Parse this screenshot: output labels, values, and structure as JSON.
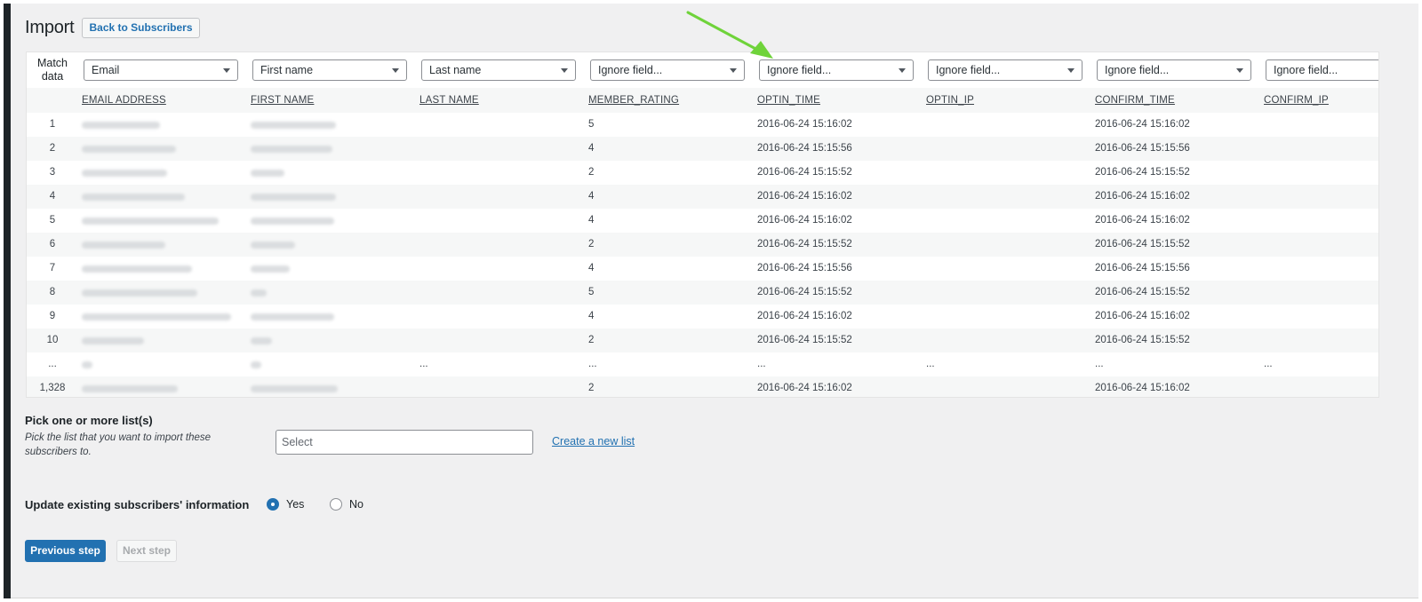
{
  "header": {
    "title": "Import",
    "back_button": "Back to Subscribers"
  },
  "match": {
    "label_line1": "Match",
    "label_line2": "data",
    "selects": [
      "Email",
      "First name",
      "Last name",
      "Ignore field...",
      "Ignore field...",
      "Ignore field...",
      "Ignore field...",
      "Ignore field..."
    ]
  },
  "columns": [
    "EMAIL ADDRESS",
    "FIRST NAME",
    "LAST NAME",
    "MEMBER_RATING",
    "OPTIN_TIME",
    "OPTIN_IP",
    "CONFIRM_TIME",
    "CONFIRM_IP"
  ],
  "rows": [
    {
      "num": "1",
      "rating": "5",
      "optin_time": "2016-06-24 15:16:02",
      "confirm_time": "2016-06-24 15:16:02"
    },
    {
      "num": "2",
      "rating": "4",
      "optin_time": "2016-06-24 15:15:56",
      "confirm_time": "2016-06-24 15:15:56"
    },
    {
      "num": "3",
      "rating": "2",
      "optin_time": "2016-06-24 15:15:52",
      "confirm_time": "2016-06-24 15:15:52"
    },
    {
      "num": "4",
      "rating": "4",
      "optin_time": "2016-06-24 15:16:02",
      "confirm_time": "2016-06-24 15:16:02"
    },
    {
      "num": "5",
      "rating": "4",
      "optin_time": "2016-06-24 15:16:02",
      "confirm_time": "2016-06-24 15:16:02"
    },
    {
      "num": "6",
      "rating": "2",
      "optin_time": "2016-06-24 15:15:52",
      "confirm_time": "2016-06-24 15:15:52"
    },
    {
      "num": "7",
      "rating": "4",
      "optin_time": "2016-06-24 15:15:56",
      "confirm_time": "2016-06-24 15:15:56"
    },
    {
      "num": "8",
      "rating": "5",
      "optin_time": "2016-06-24 15:15:52",
      "confirm_time": "2016-06-24 15:15:52"
    },
    {
      "num": "9",
      "rating": "4",
      "optin_time": "2016-06-24 15:16:02",
      "confirm_time": "2016-06-24 15:16:02"
    },
    {
      "num": "10",
      "rating": "2",
      "optin_time": "2016-06-24 15:15:52",
      "confirm_time": "2016-06-24 15:15:52"
    }
  ],
  "ellipsis_row": {
    "num": "...",
    "cell": "..."
  },
  "last_row": {
    "num": "1,328",
    "rating": "2",
    "optin_time": "2016-06-24 15:16:02",
    "confirm_time": "2016-06-24 15:16:02"
  },
  "lists": {
    "title": "Pick one or more list(s)",
    "description": "Pick the list that you want to import these subscribers to.",
    "select_placeholder": "Select",
    "create_link": "Create a new list"
  },
  "update": {
    "label": "Update existing subscribers' information",
    "yes": "Yes",
    "no": "No",
    "selected": "Yes"
  },
  "buttons": {
    "previous": "Previous step",
    "next": "Next step"
  },
  "colors": {
    "primary": "#2271b1",
    "annotation_arrow": "#6fd33a"
  }
}
